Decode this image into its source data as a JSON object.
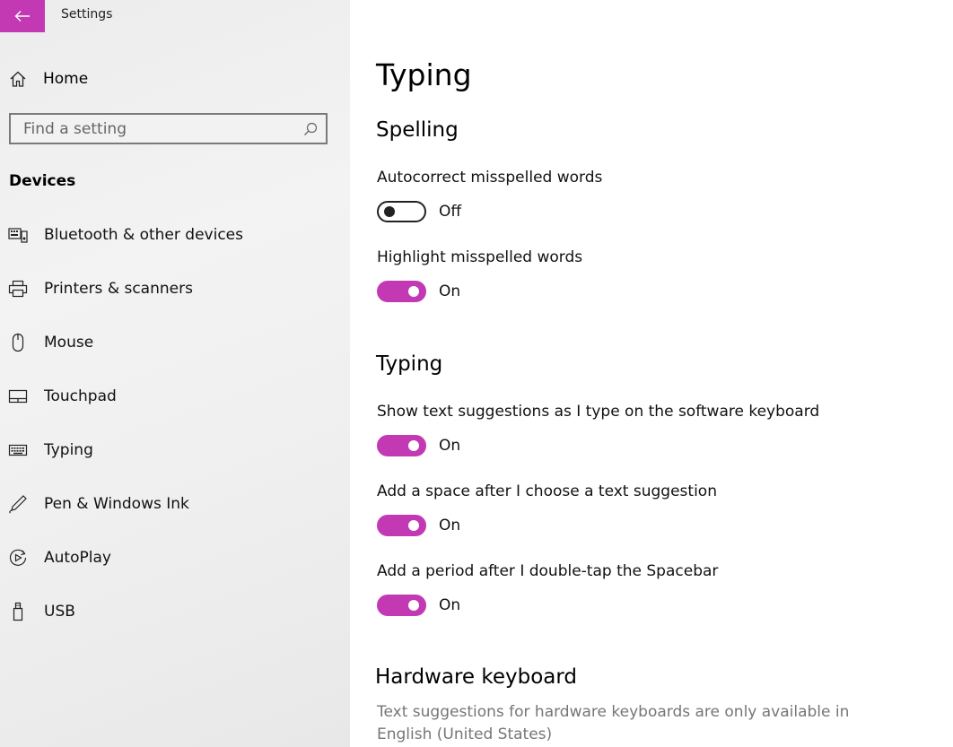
{
  "app": {
    "title": "Settings"
  },
  "sidebar": {
    "home_label": "Home",
    "search_placeholder": "Find a setting",
    "section_label": "Devices",
    "items": [
      {
        "label": "Bluetooth & other devices",
        "icon": "bluetooth-devices-icon"
      },
      {
        "label": "Printers & scanners",
        "icon": "printer-icon"
      },
      {
        "label": "Mouse",
        "icon": "mouse-icon"
      },
      {
        "label": "Touchpad",
        "icon": "touchpad-icon"
      },
      {
        "label": "Typing",
        "icon": "keyboard-icon"
      },
      {
        "label": "Pen & Windows Ink",
        "icon": "pen-icon"
      },
      {
        "label": "AutoPlay",
        "icon": "autoplay-icon"
      },
      {
        "label": "USB",
        "icon": "usb-icon"
      }
    ]
  },
  "main": {
    "title": "Typing",
    "spelling": {
      "title": "Spelling",
      "settings": [
        {
          "label": "Autocorrect misspelled words",
          "state": "Off",
          "on": false
        },
        {
          "label": "Highlight misspelled words",
          "state": "On",
          "on": true
        }
      ]
    },
    "typing": {
      "title": "Typing",
      "settings": [
        {
          "label": "Show text suggestions as I type on the software keyboard",
          "state": "On",
          "on": true
        },
        {
          "label": "Add a space after I choose a text suggestion",
          "state": "On",
          "on": true
        },
        {
          "label": "Add a period after I double-tap the Spacebar",
          "state": "On",
          "on": true
        }
      ]
    },
    "hardware": {
      "title": "Hardware keyboard",
      "description": "Text suggestions for hardware keyboards are only available in English (United States)"
    }
  },
  "colors": {
    "accent": "#c239b3",
    "sidebar_bg": "#f0f0f0",
    "muted_text": "#767676"
  }
}
